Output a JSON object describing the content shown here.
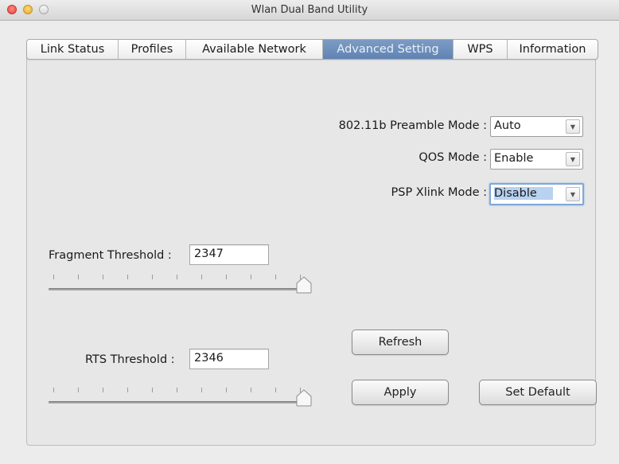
{
  "window": {
    "title": "Wlan Dual Band Utility"
  },
  "tabs": [
    {
      "label": "Link Status"
    },
    {
      "label": "Profiles"
    },
    {
      "label": "Available Network"
    },
    {
      "label": "Advanced Setting",
      "active": true
    },
    {
      "label": "WPS"
    },
    {
      "label": "Information"
    }
  ],
  "settings": {
    "preamble": {
      "label": "802.11b  Preamble Mode :",
      "value": "Auto"
    },
    "qos": {
      "label": "QOS Mode :",
      "value": "Enable"
    },
    "psp": {
      "label": "PSP Xlink Mode :",
      "value": "Disable"
    }
  },
  "fragment": {
    "label": "Fragment Threshold :",
    "value": "2347",
    "slider_fraction": 1.0
  },
  "rts": {
    "label": "RTS Threshold :",
    "value": "2346",
    "slider_fraction": 1.0
  },
  "buttons": {
    "refresh": "Refresh",
    "apply": "Apply",
    "set_default": "Set Default"
  },
  "colors": {
    "active_tab": "#6a8cba",
    "focus_ring": "#7fa8d9"
  }
}
